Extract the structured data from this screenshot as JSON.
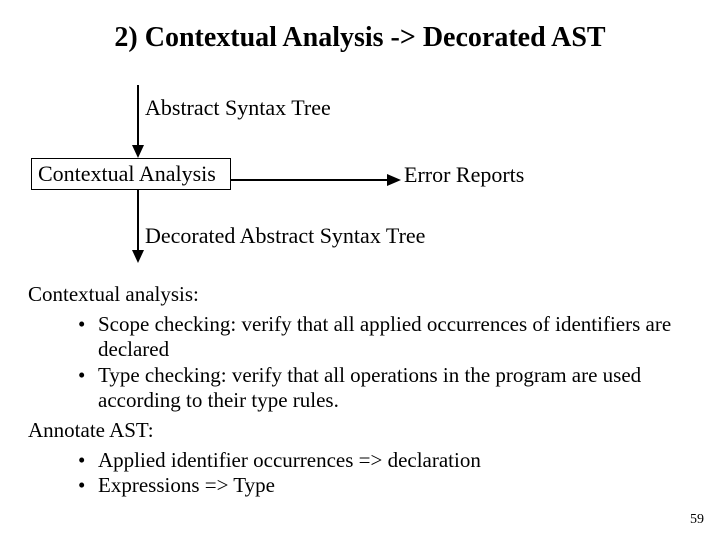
{
  "title": "2) Contextual Analysis -> Decorated AST",
  "diagram": {
    "input": "Abstract Syntax Tree",
    "box": "Contextual Analysis",
    "side_output": "Error Reports",
    "output": "Decorated Abstract Syntax Tree"
  },
  "body": {
    "ca_heading": "Contextual analysis:",
    "ca_bullets": [
      "Scope checking: verify that all applied occurrences of identifiers are declared",
      "Type checking: verify that all operations in the program are used according to their type rules."
    ],
    "annotate_heading": "Annotate AST:",
    "annotate_bullets": [
      "Applied identifier occurrences => declaration",
      "Expressions => Type"
    ]
  },
  "page_number": "59"
}
